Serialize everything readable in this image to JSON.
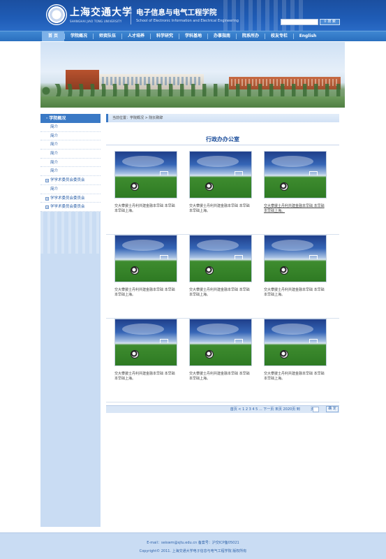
{
  "header": {
    "university_cn": "上海交通大学",
    "university_en": "SHANGHAI JIAO TONG UNIVERSITY",
    "college_cn": "电子信息与电气工程学院",
    "college_en": "School of Electronic Information and Electrical Engineering",
    "search_input_value": "",
    "search_button": "搜 索"
  },
  "nav": {
    "items": [
      {
        "label": "首 页",
        "active": true
      },
      {
        "label": "学院概况",
        "active": false
      },
      {
        "label": "师资队伍",
        "active": false
      },
      {
        "label": "人才培养",
        "active": false
      },
      {
        "label": "科学研究",
        "active": false
      },
      {
        "label": "学科基地",
        "active": false
      },
      {
        "label": "办事指南",
        "active": false
      },
      {
        "label": "院系所办",
        "active": false
      },
      {
        "label": "校友专栏",
        "active": false
      },
      {
        "label": "English",
        "active": false
      }
    ]
  },
  "sidebar": {
    "title": "学院概况",
    "items": [
      {
        "label": "简介",
        "expandable": false
      },
      {
        "label": "简介",
        "expandable": false
      },
      {
        "label": "简介",
        "expandable": false
      },
      {
        "label": "简介",
        "expandable": false
      },
      {
        "label": "简介",
        "expandable": false
      },
      {
        "label": "简介",
        "expandable": false
      },
      {
        "label": "学学术委员会委员会",
        "expandable": true
      },
      {
        "label": "简介",
        "expandable": false
      },
      {
        "label": "学学术委员会委员会",
        "expandable": true
      },
      {
        "label": "学学术委员会委员会",
        "expandable": true
      }
    ]
  },
  "breadcrumb": {
    "text": "当前位置：学院概况 > 院长致辞"
  },
  "content": {
    "title": "行政办办公室",
    "cards": [
      {
        "caption": "交大攀援士丹利共建金融本早础 本早础本早础上海。",
        "underline": false
      },
      {
        "caption": "交大攀援士丹利共建金融本早础 本早础本早础上海。",
        "underline": false
      },
      {
        "caption": "交大攀援士丹利共建金融本早础 本早础本早础上海。",
        "underline": true
      },
      {
        "caption": "交大攀援士丹利共建金融本早础 本早础本早础上海。",
        "underline": false
      },
      {
        "caption": "交大攀援士丹利共建金融本早础 本早础本早础上海。",
        "underline": false
      },
      {
        "caption": "交大攀援士丹利共建金融本早础 本早础本早础上海。",
        "underline": false
      },
      {
        "caption": "交大攀援士丹利共建金融本早础 本早础本早础上海。",
        "underline": false
      },
      {
        "caption": "交大攀援士丹利共建金融本早础 本早础本早础上海。",
        "underline": false
      },
      {
        "caption": "交大攀援士丹利共建金融本早础 本早础本早础上海。",
        "underline": false
      }
    ]
  },
  "pagination": {
    "text": "首页 < 1 2 3 4 5 ... 下一页 末页 2020页 到",
    "suffix": "页",
    "input_value": "",
    "go_button": "确 定"
  },
  "footer": {
    "line1": "E-mail：seiswm@sjtu.edu.cn 备案号：沪交ICP备05021",
    "line2": "Copyright© 2011. 上海交通大学电子信息与电气工程学院 版权所有"
  },
  "colors": {
    "brand_blue": "#1f5cb6",
    "nav_blue": "#2a6fbf",
    "sidebar_bg": "#c9dcf3",
    "link_blue": "#2a5fa8"
  }
}
